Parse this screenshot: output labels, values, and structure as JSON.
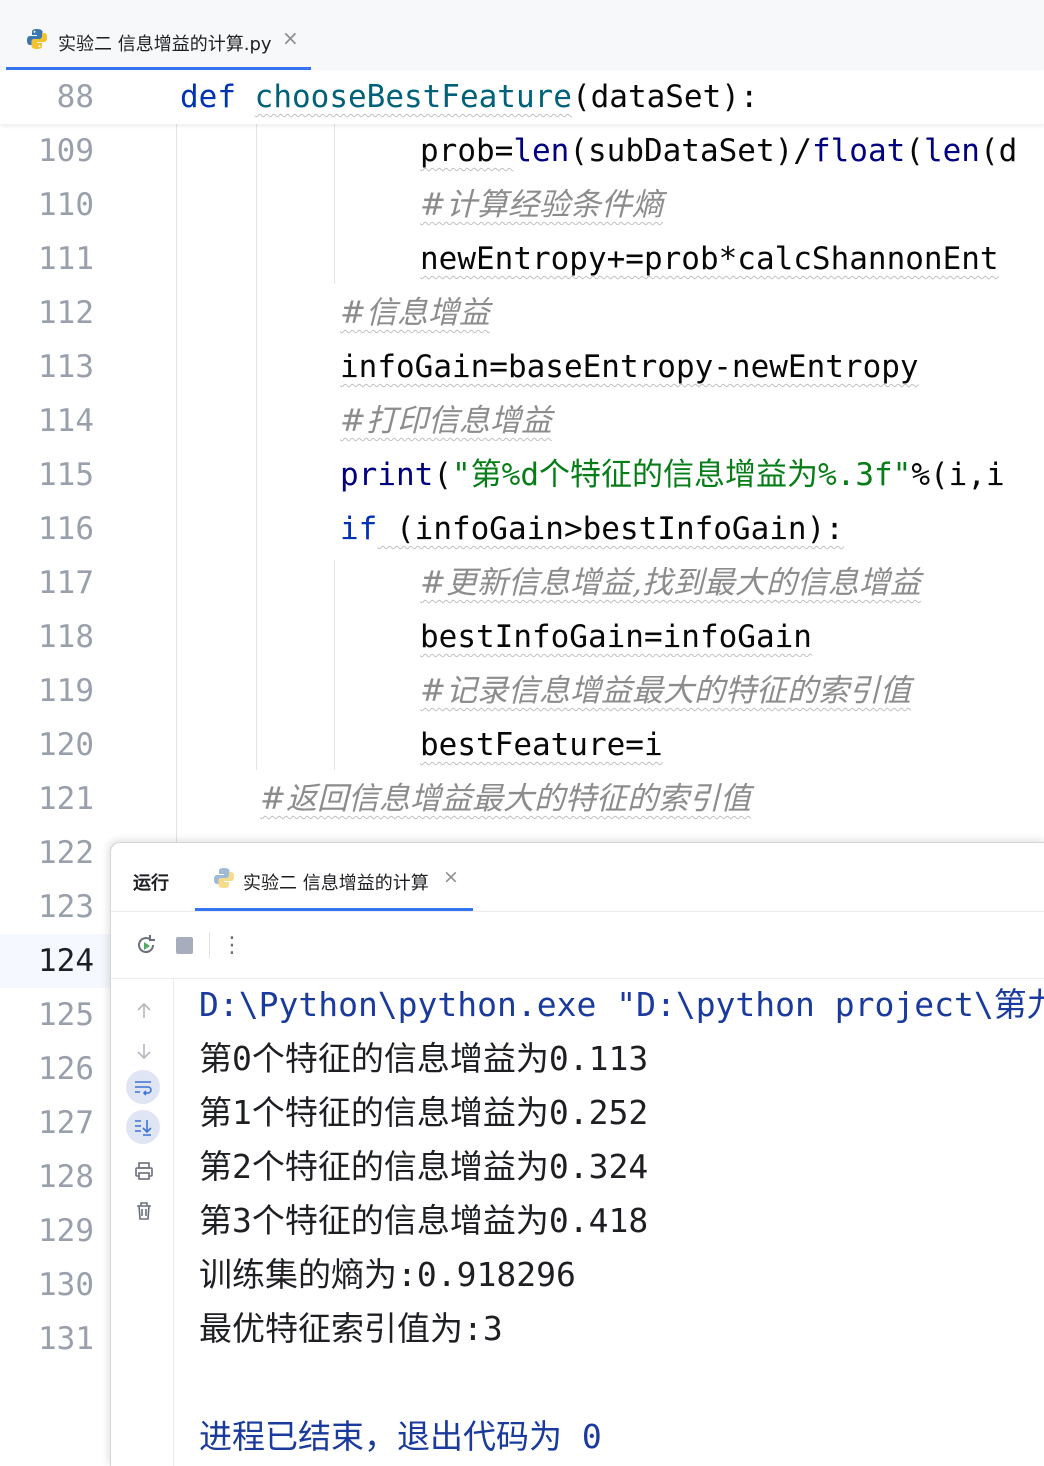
{
  "editor": {
    "file_tab": {
      "label": "实验二 信息增益的计算.py",
      "close": "×"
    },
    "sticky_line": {
      "number": "88",
      "kw": "def",
      "fn": "chooseBestFeature",
      "rest": "(dataSet):"
    },
    "line_numbers": [
      "109",
      "110",
      "111",
      "112",
      "113",
      "114",
      "115",
      "116",
      "117",
      "118",
      "119",
      "120",
      "121",
      "122",
      "123",
      "124",
      "125",
      "126",
      "127",
      "128",
      "129",
      "130",
      "131"
    ],
    "current_line": "124",
    "lines": {
      "l109": {
        "a": "prob=",
        "b": "len",
        "c": "(subDataSet)/",
        "d": "float",
        "e": "(",
        "f": "len",
        "g": "(d"
      },
      "l110": {
        "comment": "#计算经验条件熵"
      },
      "l111": {
        "text": "newEntropy+=prob*calcShannonEnt"
      },
      "l112": {
        "comment": "#信息增益"
      },
      "l113": {
        "text": "infoGain=baseEntropy-newEntropy"
      },
      "l114": {
        "comment": "#打印信息增益"
      },
      "l115": {
        "fn": "print",
        "open": "(",
        "str": "\"第%d个特征的信息增益为%.3f\"",
        "rest": "%(i,i"
      },
      "l116": {
        "kw": "if",
        "rest": " (infoGain>bestInfoGain):"
      },
      "l117": {
        "comment": "#更新信息增益,找到最大的信息增益"
      },
      "l118": {
        "text": "bestInfoGain=infoGain"
      },
      "l119": {
        "comment": "#记录信息增益最大的特征的索引值"
      },
      "l120": {
        "text": "bestFeature=i"
      },
      "l121": {
        "comment": "#返回信息增益最大的特征的索引值"
      }
    }
  },
  "run": {
    "title": "运行",
    "tab_label": "实验二 信息增益的计算",
    "tab_close": "×",
    "toolbar_more": "⋮",
    "output": [
      "D:\\Python\\python.exe \"D:\\python project\\第九",
      "第0个特征的信息增益为0.113",
      "第1个特征的信息增益为0.252",
      "第2个特征的信息增益为0.324",
      "第3个特征的信息增益为0.418",
      "训练集的熵为:0.918296",
      "最优特征索引值为:3",
      "",
      "进程已结束，退出代码为 0"
    ]
  },
  "colors": {
    "keyword": "#0033b3",
    "function": "#00627a",
    "string": "#067d17",
    "comment": "#8c8c8c",
    "accent": "#3574f0",
    "console_path": "#1a3a9c"
  }
}
